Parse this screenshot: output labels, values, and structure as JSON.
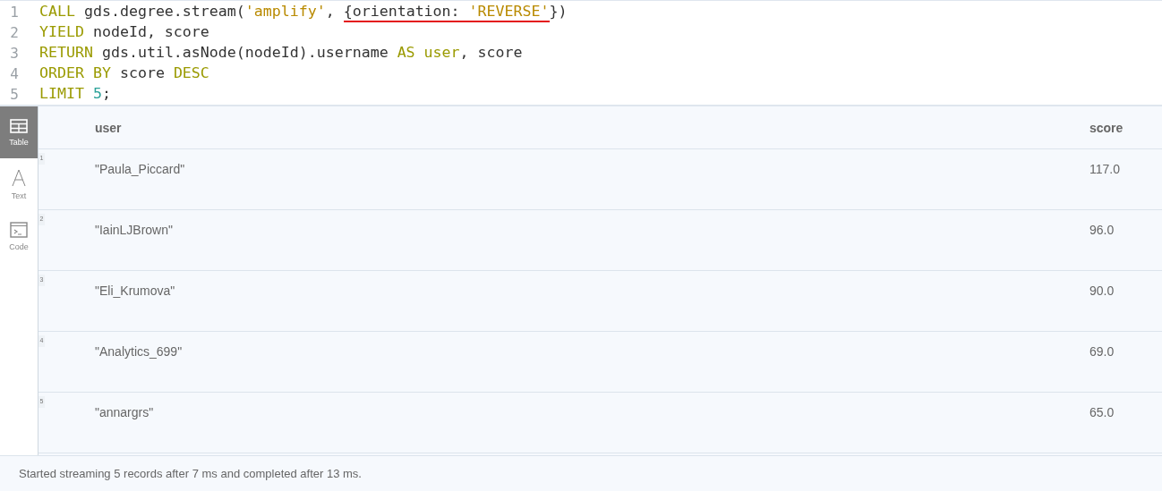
{
  "editor": {
    "lines": [
      {
        "number": "1",
        "tokens": [
          {
            "text": "CALL",
            "kind": "keyword",
            "underlined": false
          },
          {
            "text": " gds.degree.stream(",
            "kind": "plain",
            "underlined": false
          },
          {
            "text": "'amplify'",
            "kind": "string",
            "underlined": false
          },
          {
            "text": ", ",
            "kind": "plain",
            "underlined": false
          },
          {
            "text": "{orientation: ",
            "kind": "plain",
            "underlined": true
          },
          {
            "text": "'REVERSE'",
            "kind": "string",
            "underlined": true
          },
          {
            "text": "})",
            "kind": "plain",
            "underlined": false
          }
        ]
      },
      {
        "number": "2",
        "tokens": [
          {
            "text": "YIELD",
            "kind": "keyword",
            "underlined": false
          },
          {
            "text": " nodeId, score",
            "kind": "plain",
            "underlined": false
          }
        ]
      },
      {
        "number": "3",
        "tokens": [
          {
            "text": "RETURN",
            "kind": "keyword",
            "underlined": false
          },
          {
            "text": " gds.util.asNode(nodeId).username ",
            "kind": "plain",
            "underlined": false
          },
          {
            "text": "AS user",
            "kind": "keyword",
            "underlined": false
          },
          {
            "text": ", score",
            "kind": "plain",
            "underlined": false
          }
        ]
      },
      {
        "number": "4",
        "tokens": [
          {
            "text": "ORDER BY",
            "kind": "keyword",
            "underlined": false
          },
          {
            "text": " score ",
            "kind": "plain",
            "underlined": false
          },
          {
            "text": "DESC",
            "kind": "keyword",
            "underlined": false
          }
        ]
      },
      {
        "number": "5",
        "tokens": [
          {
            "text": "LIMIT ",
            "kind": "keyword",
            "underlined": false
          },
          {
            "text": "5",
            "kind": "number",
            "underlined": false
          },
          {
            "text": ";",
            "kind": "plain",
            "underlined": false
          }
        ]
      }
    ]
  },
  "view_tabs": [
    {
      "label": "Table",
      "kind": "table",
      "selected": true
    },
    {
      "label": "Text",
      "kind": "text",
      "selected": false
    },
    {
      "label": "Code",
      "kind": "code",
      "selected": false
    }
  ],
  "table": {
    "columns": [
      "user",
      "score"
    ],
    "rows": [
      {
        "index": "1",
        "cells": [
          "\"Paula_Piccard\"",
          "117.0"
        ]
      },
      {
        "index": "2",
        "cells": [
          "\"IainLJBrown\"",
          "96.0"
        ]
      },
      {
        "index": "3",
        "cells": [
          "\"Eli_Krumova\"",
          "90.0"
        ]
      },
      {
        "index": "4",
        "cells": [
          "\"Analytics_699\"",
          "69.0"
        ]
      },
      {
        "index": "5",
        "cells": [
          "\"annargrs\"",
          "65.0"
        ]
      }
    ]
  },
  "status_bar": "Started streaming 5 records after 7 ms and completed after 13 ms."
}
